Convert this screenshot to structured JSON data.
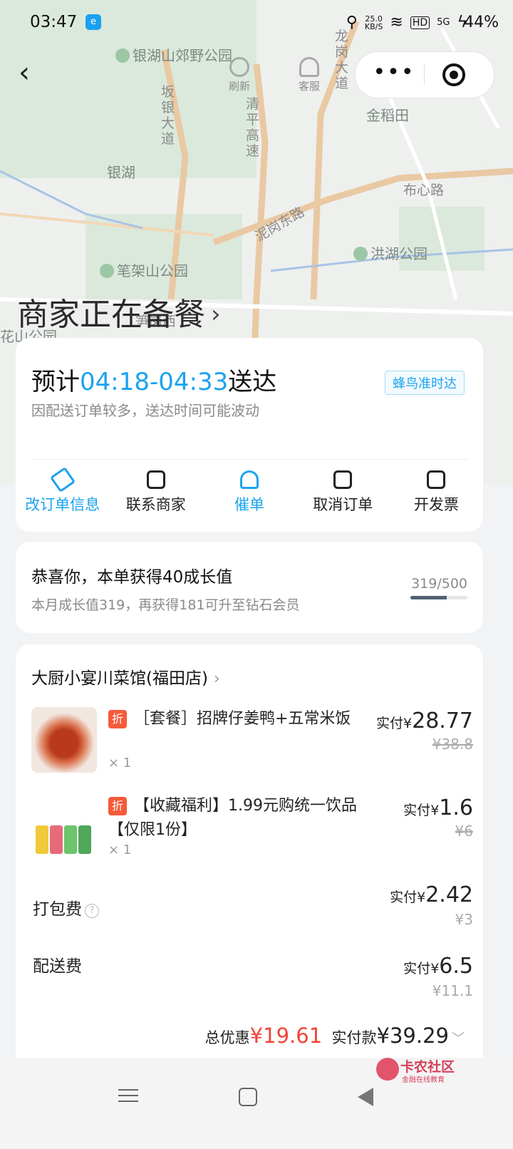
{
  "status_bar": {
    "time": "03:47",
    "app_badge": "e",
    "net_speed_value": "25.0",
    "net_speed_unit": "KB/S",
    "hd": "HD",
    "signal": "5G",
    "battery": "44%"
  },
  "map": {
    "labels": [
      "银湖山郊野公园",
      "坂银大道",
      "清平高速",
      "龙岗大道",
      "金稻田",
      "银湖",
      "布心路",
      "泥岗东路",
      "洪湖公园",
      "笔架山公园",
      "花山公园",
      "笋岗西"
    ]
  },
  "top_nav": {
    "refresh_label": "刷新",
    "service_label": "客服",
    "more_symbol": "•••"
  },
  "order_status": {
    "title": "商家正在备餐",
    "chevron": "›"
  },
  "delivery": {
    "eta_prefix": "预计",
    "eta_time": "04:18-04:33",
    "eta_suffix": "送达",
    "badge": "蜂鸟准时达",
    "note": "因配送订单较多，送达时间可能波动",
    "actions": [
      {
        "label": "改订单信息",
        "icon": "edit-icon",
        "color": "#1aa3ee"
      },
      {
        "label": "联系商家",
        "icon": "chat-icon",
        "color": "#222222"
      },
      {
        "label": "催单",
        "icon": "bell-icon",
        "color": "#1aa3ee"
      },
      {
        "label": "取消订单",
        "icon": "cancel-doc-icon",
        "color": "#222222"
      },
      {
        "label": "开发票",
        "icon": "invoice-icon",
        "color": "#222222"
      }
    ]
  },
  "growth": {
    "title": "恭喜你，本单获得40成长值",
    "subtitle": "本月成长值319，再获得181可升至钻石会员",
    "progress_text": "319/500",
    "progress_fraction": 0.638
  },
  "order": {
    "shop_name": "大厨小宴川菜馆(福田店)",
    "chevron": "›",
    "discount_tag": "折",
    "paid_label": "实付",
    "currency": "¥",
    "items": [
      {
        "name": "［套餐］招牌仔姜鸭+五常米饭",
        "qty": "× 1",
        "paid": "28.77",
        "original": "¥38.8"
      },
      {
        "name": "【收藏福利】1.99元购统一饮品【仅限1份】",
        "qty": "× 1",
        "paid": "1.6",
        "original": "¥6"
      }
    ],
    "packing": {
      "label": "打包费",
      "help": "?",
      "paid": "2.42",
      "original": "¥3"
    },
    "delivery_fee": {
      "label": "配送费",
      "paid": "6.5",
      "original": "¥11.1"
    },
    "total": {
      "discount_label": "总优惠",
      "discount_value": "¥19.61",
      "paid_label": "实付款",
      "paid_value": "¥39.29",
      "chevron": "﹀"
    }
  },
  "watermark": {
    "main": "卡农社区",
    "sub": "金融在线教育"
  }
}
